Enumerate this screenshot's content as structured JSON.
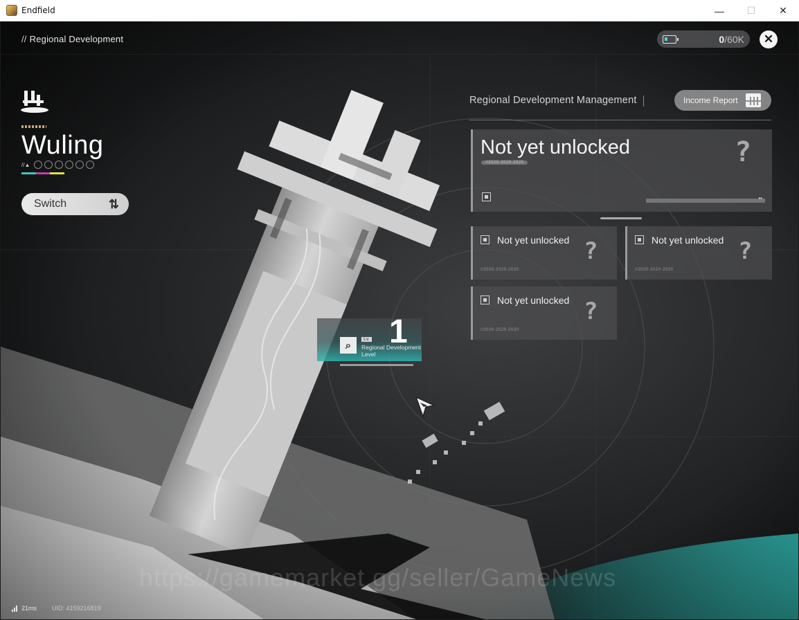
{
  "window": {
    "title": "Endfield",
    "minimize": "—",
    "maximize": "☐",
    "close": "✕"
  },
  "header": {
    "breadcrumb_prefix": "//",
    "breadcrumb": "Regional Development",
    "currency_value": "0",
    "currency_max": "/60K",
    "close_icon": "✕"
  },
  "region": {
    "name": "Wuling",
    "dots_tag": "//▲",
    "bar_colors": [
      "#39c8c2",
      "#c43bb0",
      "#e1e23a"
    ],
    "switch_label": "Switch",
    "switch_icon": "⇅"
  },
  "management": {
    "title": "Regional Development Management",
    "income_report_label": "Income Report",
    "cards": [
      {
        "title": "Not yet unlocked",
        "code": "//2020·2020·2020",
        "mark": "?"
      },
      {
        "title": "Not yet unlocked",
        "code": "//2020·2020·2020",
        "mark": "?"
      },
      {
        "title": "Not yet unlocked",
        "code": "//2020·2020·2020",
        "mark": "?"
      },
      {
        "title": "Not yet unlocked",
        "code": "//2020·2020·2020",
        "mark": "?"
      }
    ]
  },
  "level": {
    "search_icon": "⌕",
    "lv": "Lv.",
    "label": "Regional Development Level",
    "value": "1"
  },
  "status": {
    "ping": "21ms",
    "uid": "UID: 4159216819"
  },
  "watermark": "https://gamemarket.gg/seller/GameNews",
  "colors": {
    "accent_teal": "#39c8c2",
    "panel": "#4e4e50"
  }
}
